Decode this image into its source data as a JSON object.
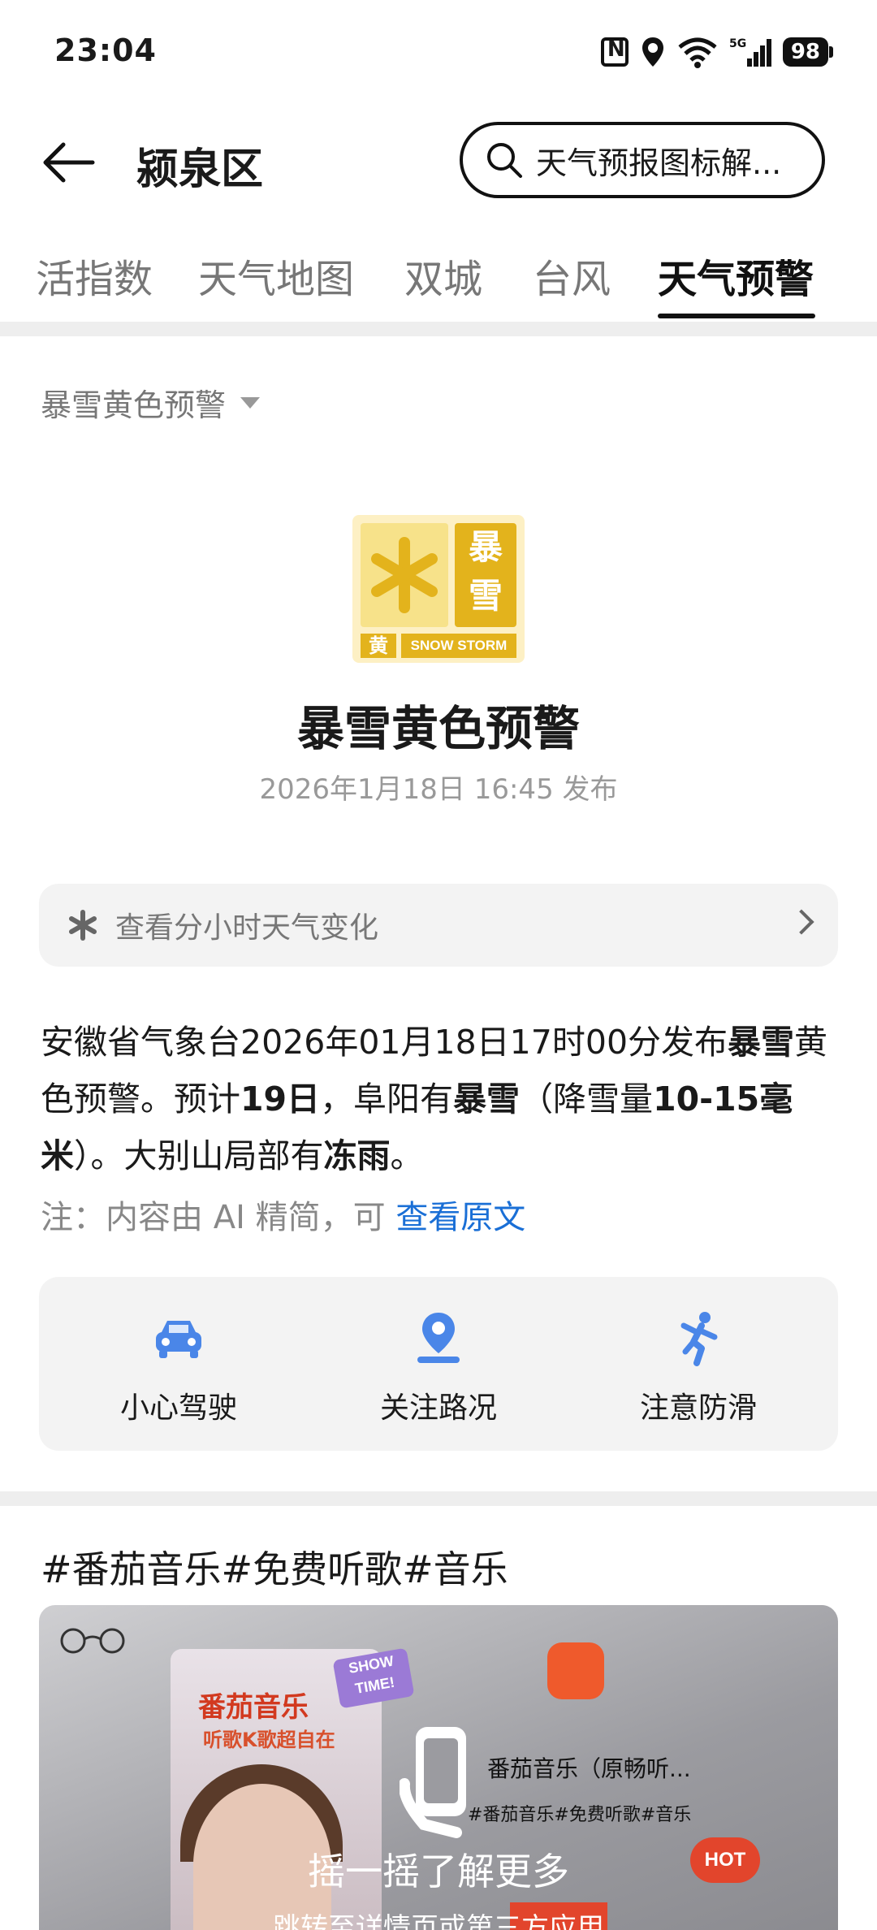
{
  "status_bar": {
    "time": "23:04",
    "battery": "98",
    "network": "5G"
  },
  "header": {
    "title": "颍泉区",
    "search_text": "天气预报图标解..."
  },
  "tabs": [
    {
      "label": "活指数"
    },
    {
      "label": "天气地图"
    },
    {
      "label": "双城"
    },
    {
      "label": "台风"
    },
    {
      "label": "天气预警"
    }
  ],
  "active_tab": "天气预警",
  "alert": {
    "selector_label": "暴雪黄色预警",
    "icon": {
      "char_top": "暴",
      "char_bottom": "雪",
      "level": "黄",
      "english": "SNOW STORM"
    },
    "title": "暴雪黄色预警",
    "published": "2026年1月18日 16:45 发布"
  },
  "hourly": {
    "label": "查看分小时天气变化"
  },
  "description": {
    "p1": "安徽省气象台2026年01月18日17时00分发布",
    "b1": "暴雪",
    "p2": "黄色预警。预计",
    "b2": "19日",
    "p3": "，阜阳有",
    "b3": "暴雪",
    "p4": "（降雪量",
    "b4": "10-15毫米",
    "p5": "）。大别山局部有",
    "b5": "冻雨",
    "p6": "。"
  },
  "note": {
    "text": "注：内容由 AI 精简，可 ",
    "link": "查看原文"
  },
  "tips": [
    {
      "icon": "car-icon",
      "label": "小心驾驶"
    },
    {
      "icon": "location-pin-icon",
      "label": "关注路况"
    },
    {
      "icon": "slip-icon",
      "label": "注意防滑"
    }
  ],
  "ad": {
    "heading": "#番茄音乐#免费听歌#音乐",
    "poster_title": "番茄音乐",
    "poster_subtitle": "听歌K歌超自在",
    "show_time": "SHOW TIME!",
    "app_name": "番茄音乐（原畅听...",
    "app_tags": "#番茄音乐#免费听歌#音乐",
    "shake_text": "摇一摇了解更多",
    "jump_text": "跳转至详情页或第三方应用",
    "hot": "HOT"
  },
  "colors": {
    "accent_link": "#1a6fd6",
    "warning_yellow": "#e3b31c",
    "icon_blue": "#4a86e8"
  }
}
